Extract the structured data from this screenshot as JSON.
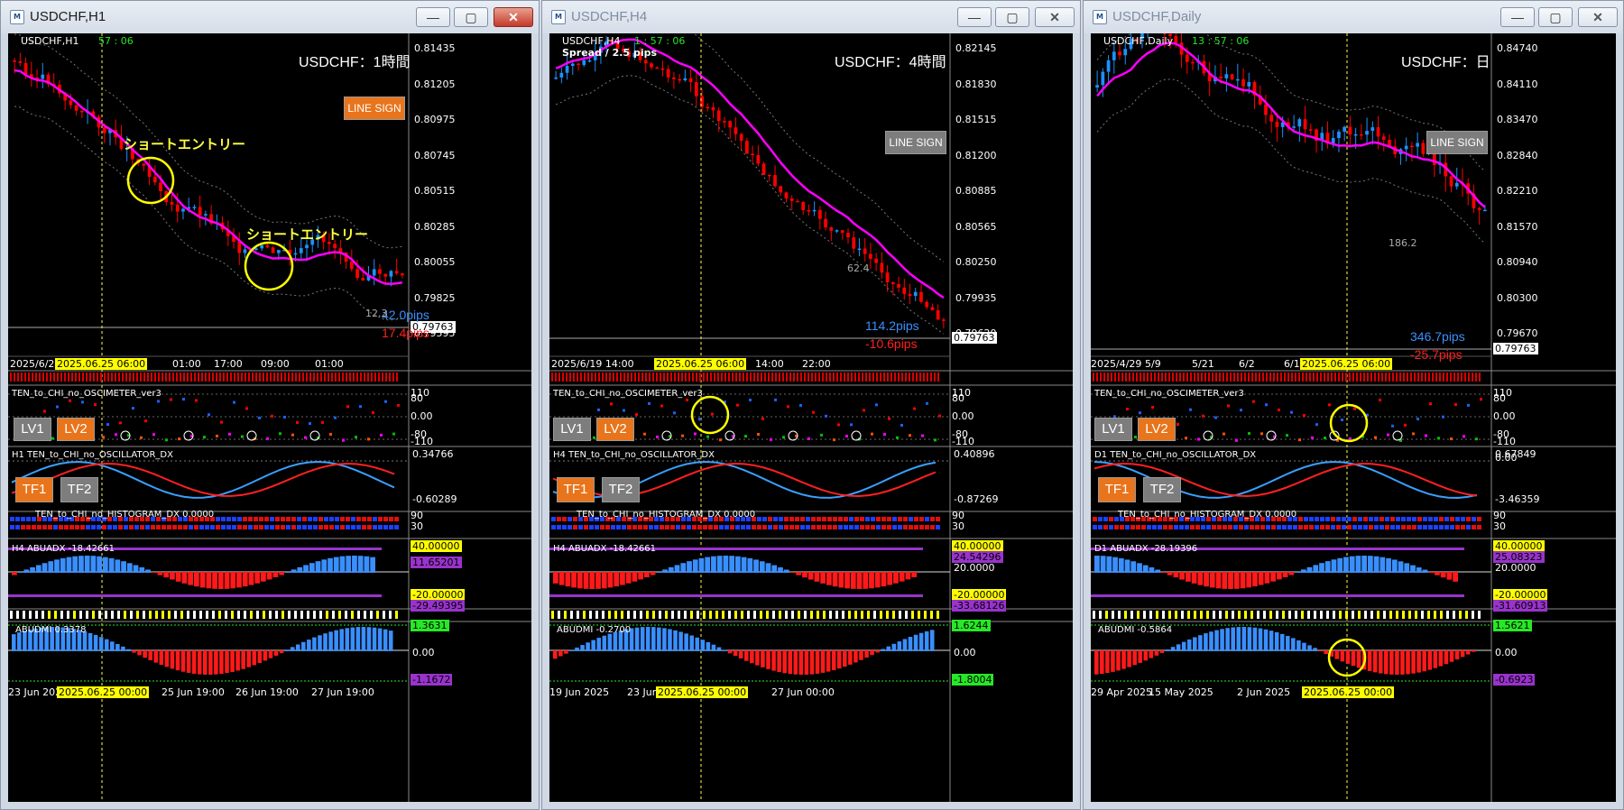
{
  "windows": [
    {
      "title": "USDCHF,H1",
      "active": true,
      "symbol": "USDCHF,H1",
      "timer": "57 : 06",
      "heading": "USDCHF：1時間",
      "line_sign": "LINE SIGN",
      "annotations": [
        "ショートエントリー",
        "ショートエントリー"
      ],
      "price_scale": [
        "0.81435",
        "0.81205",
        "0.80975",
        "0.80745",
        "0.80515",
        "0.80285",
        "0.80055",
        "0.79825",
        "0.79595"
      ],
      "current_price": "0.79763",
      "pips_up": "42.0pips",
      "pips_down": "17.4pips",
      "side_value": "12.3",
      "x_axis": [
        "2025/6/24",
        "01:00",
        "17:00",
        "09:00",
        "01:00"
      ],
      "date_marker": "2025.06.25 06:00",
      "ind1_title": "TEN_to_CHI_no_OSCIMETER_ver3",
      "ind1_scale": [
        "110",
        "80",
        "0.00",
        "-80",
        "-110"
      ],
      "lv1": "LV1",
      "lv2": "LV2",
      "ind2_title": "H1 TEN_to_CHI_no_OSCILLATOR_DX",
      "ind2_scale": [
        "0.34766",
        "-0.60289"
      ],
      "tf1": "TF1",
      "tf2": "TF2",
      "ind3_title": "TEN_to_CHI_no_HISTOGRAM_DX 0.0000",
      "ind3_scale": [
        "90",
        "30"
      ],
      "ind4_title": "H4 ABUADX -18.42661",
      "ind4_scale": [
        "40.00000",
        "11.65201",
        "-20.00000",
        "-29.49395"
      ],
      "ind5_title": "ABUDMI 0.3378",
      "ind5_scale": [
        "1.3631",
        "0.00",
        "-1.1672"
      ],
      "bottom_axis": [
        "23 Jun 2025",
        "25 Jun 19:00",
        "26 Jun 19:00",
        "27 Jun 19:00"
      ],
      "bottom_marker": "2025.06.25 00:00"
    },
    {
      "title": "USDCHF,H4",
      "active": false,
      "symbol": "USDCHF,H4",
      "timer": "1 : 57 : 06",
      "spread": "Spread / 2.5 pips",
      "heading": "USDCHF：4時間",
      "line_sign": "LINE SIGN",
      "price_scale": [
        "0.82145",
        "0.81830",
        "0.81515",
        "0.81200",
        "0.80885",
        "0.80565",
        "0.80250",
        "0.79935",
        "0.79620"
      ],
      "current_price": "0.79763",
      "pips_up": "114.2pips",
      "pips_down": "-10.6pips",
      "side_value": "62.4",
      "x_axis": [
        "2025/6/19 14:00",
        "14:00",
        "22:00"
      ],
      "date_marker": "2025.06.25 06:00",
      "ind1_title": "TEN_to_CHI_no_OSCIMETER_ver3",
      "ind1_scale": [
        "110",
        "80",
        "0.00",
        "-80",
        "-110"
      ],
      "lv1": "LV1",
      "lv2": "LV2",
      "ind2_title": "H4 TEN_to_CHI_no_OSCILLATOR_DX",
      "ind2_scale": [
        "0.40896",
        "-0.87269"
      ],
      "tf1": "TF1",
      "tf2": "TF2",
      "ind3_title": "TEN_to_CHI_no_HISTOGRAM_DX 0.0000",
      "ind3_scale": [
        "90",
        "30"
      ],
      "ind4_title": "H4 ABUADX -18.42661",
      "ind4_scale": [
        "40.00000",
        "24.54296",
        "20.0000",
        "-20.00000",
        "-33.68126"
      ],
      "ind5_title": "ABUDMI -0.2700",
      "ind5_scale": [
        "1.6244",
        "0.00",
        "-1.8004"
      ],
      "bottom_axis": [
        "19 Jun 2025",
        "23 Jun",
        "27 Jun 00:00"
      ],
      "bottom_marker": "2025.06.25 00:00"
    },
    {
      "title": "USDCHF,Daily",
      "active": false,
      "symbol": "USDCHF,Daily",
      "timer": "13 : 57 : 06",
      "heading": "USDCHF：日",
      "line_sign": "LINE SIGN",
      "price_scale": [
        "0.84740",
        "0.84110",
        "0.83470",
        "0.82840",
        "0.82210",
        "0.81570",
        "0.80940",
        "0.80300",
        "0.79670"
      ],
      "current_price": "0.79763",
      "pips_up": "346.7pips",
      "pips_down": "-25.7pips",
      "side_value": "186.2",
      "x_axis": [
        "2025/4/29",
        "5/9",
        "5/21",
        "6/2",
        "6/1"
      ],
      "date_marker": "2025.06.25 06:00",
      "ind1_title": "TEN_to_CHI_no_OSCIMETER_ver3",
      "ind1_scale": [
        "110",
        "80",
        "0.00",
        "-80",
        "-110"
      ],
      "lv1": "LV1",
      "lv2": "LV2",
      "ind2_title": "D1 TEN_to_CHI_no_OSCILLATOR_DX",
      "ind2_scale": [
        "0.67849",
        "0.00",
        "-3.46359"
      ],
      "tf1": "TF1",
      "tf2": "TF2",
      "ind3_title": "TEN_to_CHI_no_HISTOGRAM_DX 0.0000",
      "ind3_scale": [
        "90",
        "30"
      ],
      "ind4_title": "D1 ABUADX -28.19396",
      "ind4_scale": [
        "40.00000",
        "25.08323",
        "20.0000",
        "-20.00000",
        "-31.60913"
      ],
      "ind5_title": "ABUDMI -0.5864",
      "ind5_scale": [
        "1.5621",
        "0.00",
        "-0.6923"
      ],
      "bottom_axis": [
        "29 Apr 2025",
        "15 May 2025",
        "2 Jun 2025"
      ],
      "bottom_marker": "2025.06.25 00:00"
    }
  ],
  "colors": {
    "bull": "#1e90ff",
    "bear": "#ff0000",
    "ma": "#ff00ff",
    "highlight": "#ffff00",
    "active_close": "#c4392a"
  }
}
